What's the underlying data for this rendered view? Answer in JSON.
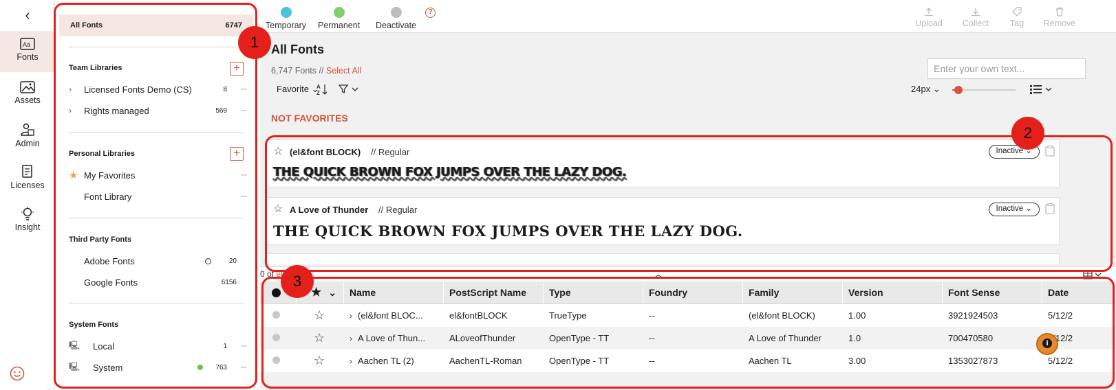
{
  "rail": {
    "items": [
      {
        "label": "Fonts"
      },
      {
        "label": "Assets"
      },
      {
        "label": "Admin"
      },
      {
        "label": "Licenses"
      },
      {
        "label": "Insight"
      }
    ]
  },
  "sidebar": {
    "all_fonts": {
      "label": "All Fonts",
      "count": "6747"
    },
    "team_title": "Team Libraries",
    "team": [
      {
        "label": "Licensed Fonts Demo (CS)",
        "count": "8"
      },
      {
        "label": "Rights managed",
        "count": "569"
      }
    ],
    "personal_title": "Personal Libraries",
    "personal": [
      {
        "label": "My Favorites"
      },
      {
        "label": "Font Library"
      }
    ],
    "third_title": "Third Party Fonts",
    "third": [
      {
        "label": "Adobe Fonts",
        "count": "20"
      },
      {
        "label": "Google Fonts",
        "count": "6156"
      }
    ],
    "system_title": "System Fonts",
    "system": [
      {
        "label": "Local",
        "count": "1"
      },
      {
        "label": "System",
        "count": "763"
      }
    ]
  },
  "toolbar": {
    "temporary": "Temporary",
    "permanent": "Permanent",
    "deactivate": "Deactivate",
    "upload": "Upload",
    "collect": "Collect",
    "tag": "Tag",
    "remove": "Remove",
    "colors": {
      "temporary": "#4cc3d9",
      "permanent": "#7fd16b",
      "deactivate": "#bdbdbd",
      "accent": "#d4553a"
    }
  },
  "main": {
    "title": "All Fonts",
    "count_text": "6,747 Fonts //",
    "select_all": "Select All",
    "text_placeholder": "Enter your own text...",
    "favorite_label": "Favorite",
    "size_label": "24px",
    "slider_value": 0.1,
    "section": "NOT FAVORITES"
  },
  "cards": [
    {
      "name": "(el&font BLOCK)",
      "style": "// Regular",
      "status": "Inactive",
      "sample": "THE QUICK BROWN FOX JUMPS OVER THE LAZY DOG."
    },
    {
      "name": "A Love of Thunder",
      "style": "// Regular",
      "status": "Inactive",
      "sample": "THE QUICK BROWN FOX JUMPS OVER THE LAZY DOG."
    }
  ],
  "table": {
    "sel_prefix": "0 of",
    "sel_link": "elect All",
    "columns": [
      "Name",
      "PostScript Name",
      "Type",
      "Foundry",
      "Family",
      "Version",
      "Font Sense",
      "Date"
    ],
    "rows": [
      {
        "name": "(el&font BLOC...",
        "ps": "el&fontBLOCK",
        "type": "TrueType",
        "foundry": "--",
        "family": "(el&font BLOCK)",
        "version": "1.00",
        "sense": "3921924503",
        "date": "5/12/2"
      },
      {
        "name": "A Love of Thun...",
        "ps": "ALoveofThunder",
        "type": "OpenType - TT",
        "foundry": "--",
        "family": "A Love of Thunder",
        "version": "1.0",
        "sense": "700470580",
        "date": "5/12/2"
      },
      {
        "name": "Aachen TL (2)",
        "ps": "AachenTL-Roman",
        "type": "OpenType - TT",
        "foundry": "--",
        "family": "Aachen TL",
        "version": "3.00",
        "sense": "1353027873",
        "date": "5/12/2"
      }
    ]
  },
  "callouts": [
    "1",
    "2",
    "3"
  ]
}
